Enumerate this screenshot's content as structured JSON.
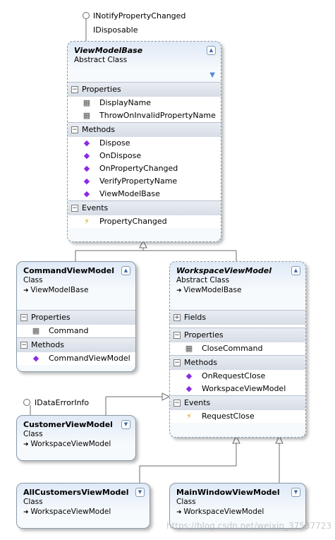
{
  "interfaces": {
    "inotify": "INotifyPropertyChanged",
    "idisposable": "IDisposable",
    "idataerror": "IDataErrorInfo"
  },
  "viewmodelbase": {
    "name": "ViewModelBase",
    "kind": "Abstract Class",
    "sections": {
      "properties": "Properties",
      "methods": "Methods",
      "events": "Events"
    },
    "properties": [
      "DisplayName",
      "ThrowOnInvalidPropertyName"
    ],
    "methods": [
      "Dispose",
      "OnDispose",
      "OnPropertyChanged",
      "VerifyPropertyName",
      "ViewModelBase"
    ],
    "events": [
      "PropertyChanged"
    ]
  },
  "commandviewmodel": {
    "name": "CommandViewModel",
    "kind": "Class",
    "base": "ViewModelBase",
    "sections": {
      "properties": "Properties",
      "methods": "Methods"
    },
    "properties": [
      "Command"
    ],
    "methods": [
      "CommandViewModel"
    ]
  },
  "workspaceviewmodel": {
    "name": "WorkspaceViewModel",
    "kind": "Abstract Class",
    "base": "ViewModelBase",
    "sections": {
      "fields": "Fields",
      "properties": "Properties",
      "methods": "Methods",
      "events": "Events"
    },
    "properties": [
      "CloseCommand"
    ],
    "methods": [
      "OnRequestClose",
      "WorkspaceViewModel"
    ],
    "events": [
      "RequestClose"
    ]
  },
  "customerviewmodel": {
    "name": "CustomerViewModel",
    "kind": "Class",
    "base": "WorkspaceViewModel"
  },
  "allcustomersviewmodel": {
    "name": "AllCustomersViewModel",
    "kind": "Class",
    "base": "WorkspaceViewModel"
  },
  "mainwindowviewmodel": {
    "name": "MainWindowViewModel",
    "kind": "Class",
    "base": "WorkspaceViewModel"
  },
  "watermark": "https://blog.csdn.net/weixin_37537723"
}
